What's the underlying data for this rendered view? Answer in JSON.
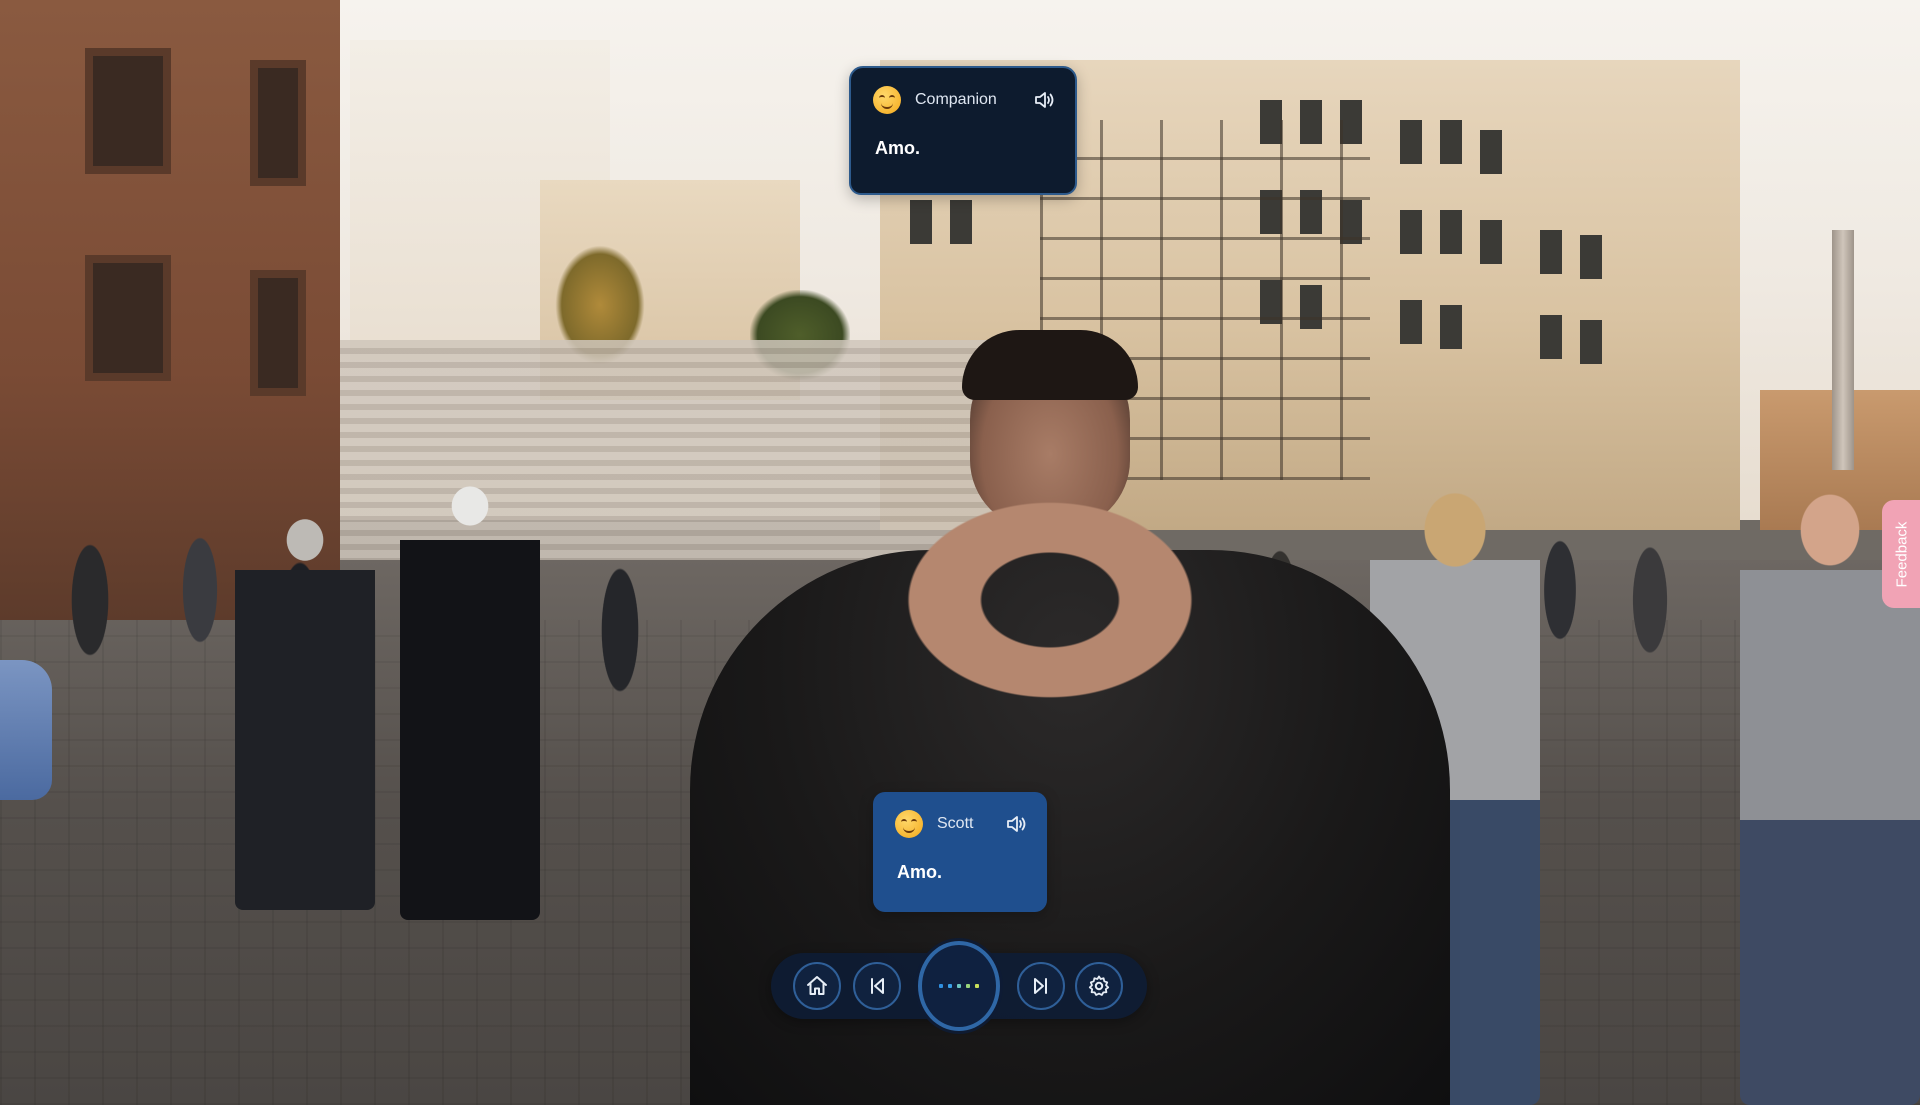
{
  "companion_bubble": {
    "speaker": "Companion",
    "text": "Amo.",
    "avatar_icon": "smiling-face-emoji",
    "audio_icon": "speaker-icon"
  },
  "user_bubble": {
    "speaker": "Scott",
    "text": "Amo.",
    "avatar_icon": "smiling-face-emoji",
    "audio_icon": "speaker-icon"
  },
  "controls": {
    "home_icon": "home-icon",
    "previous_icon": "skip-back-icon",
    "main_icon": "listening-dots-icon",
    "next_icon": "skip-forward-icon",
    "settings_icon": "gear-icon",
    "dot_colors": [
      "#2f8fe0",
      "#3aa0e8",
      "#6cc6c0",
      "#9ad57a",
      "#c8e05a"
    ]
  },
  "feedback": {
    "label": "Feedback"
  },
  "colors": {
    "companion_bubble_bg": "#0d1b2e",
    "user_bubble_bg": "#1f4f8e",
    "control_bar_bg": "#0e1c34",
    "feedback_bg": "#f1a3b5"
  }
}
